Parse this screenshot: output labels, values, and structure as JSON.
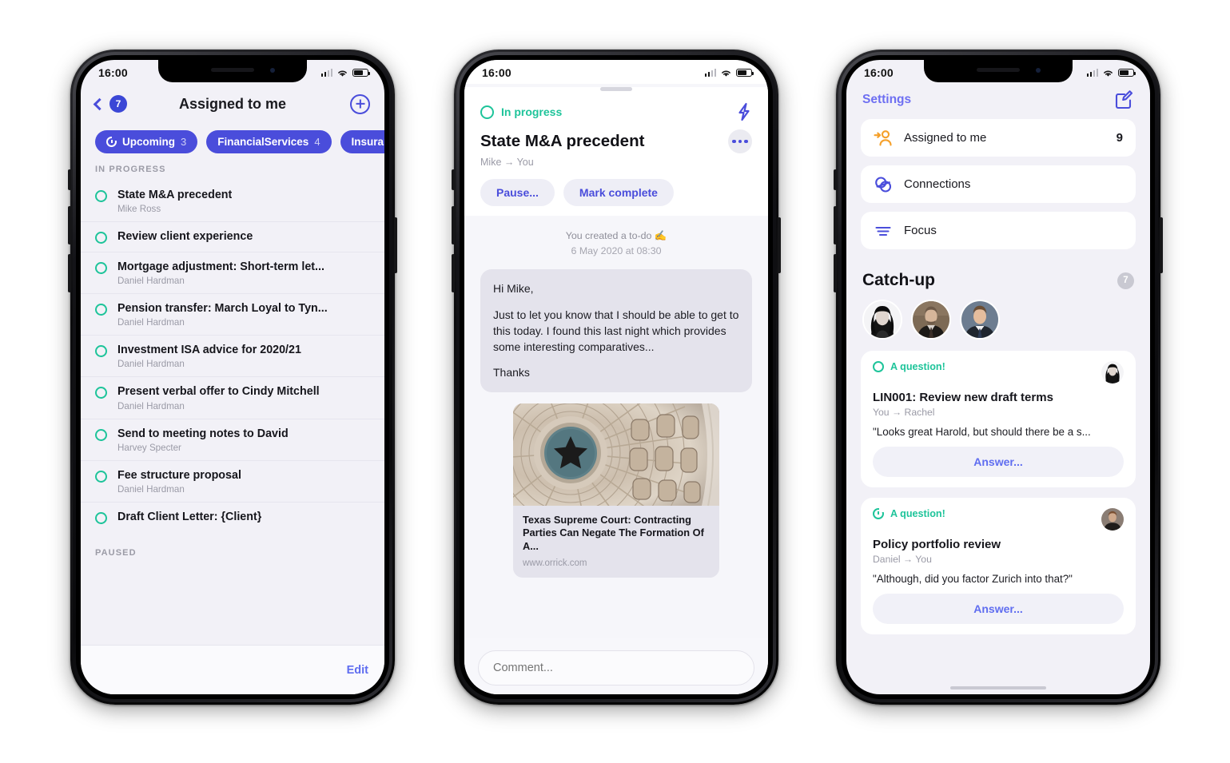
{
  "status_bar": {
    "time": "16:00"
  },
  "phone1": {
    "nav": {
      "back_badge": "7",
      "title": "Assigned to me",
      "add_label": "add-todo"
    },
    "filters": [
      {
        "label": "Upcoming",
        "count": "3",
        "icon": "clock-icon"
      },
      {
        "label": "FinancialServices",
        "count": "4",
        "icon": ""
      },
      {
        "label": "Insurance",
        "count": "",
        "icon": ""
      }
    ],
    "section_in_progress": "IN PROGRESS",
    "section_paused": "PAUSED",
    "tasks": [
      {
        "title": "State M&A precedent",
        "assignee": "Mike Ross"
      },
      {
        "title": "Review client experience",
        "assignee": ""
      },
      {
        "title": "Mortgage adjustment: Short-term let...",
        "assignee": "Daniel Hardman"
      },
      {
        "title": "Pension transfer: March Loyal to Tyn...",
        "assignee": "Daniel Hardman"
      },
      {
        "title": "Investment ISA advice for 2020/21",
        "assignee": "Daniel Hardman"
      },
      {
        "title": "Present verbal offer to Cindy Mitchell",
        "assignee": "Daniel Hardman"
      },
      {
        "title": "Send to meeting notes  to David",
        "assignee": "Harvey Specter"
      },
      {
        "title": "Fee structure proposal",
        "assignee": "Daniel Hardman"
      },
      {
        "title": "Draft Client Letter: {Client}",
        "assignee": ""
      }
    ],
    "footer": {
      "edit_label": "Edit"
    }
  },
  "phone2": {
    "status": {
      "label": "In progress"
    },
    "title": "State M&A precedent",
    "participants": "Mike → You",
    "actions": {
      "pause": "Pause...",
      "complete": "Mark complete"
    },
    "event": {
      "text": "You created a to-do ✍️",
      "date": "6 May 2020 at 08:30"
    },
    "message": {
      "greeting": "Hi Mike,",
      "body": "Just to let you know that I should be able to get to this today. I found this last night which provides some interesting comparatives...",
      "signoff": "Thanks"
    },
    "link_card": {
      "title": "Texas Supreme Court: Contracting Parties Can Negate The Formation Of A...",
      "url": "www.orrick.com",
      "image_alt": "texas-capitol-rotunda-photo"
    },
    "comment_placeholder": "Comment..."
  },
  "phone3": {
    "nav": {
      "settings": "Settings",
      "compose": "compose-icon"
    },
    "settings_items": [
      {
        "label": "Assigned to me",
        "count": "9",
        "icon": "assigned-person-icon"
      },
      {
        "label": "Connections",
        "count": "",
        "icon": "connections-icon"
      },
      {
        "label": "Focus",
        "count": "",
        "icon": "focus-icon"
      }
    ],
    "catchup": {
      "title": "Catch-up",
      "badge": "7",
      "avatars": [
        "avatar-rachel",
        "avatar-daniel",
        "avatar-mike"
      ],
      "cards": [
        {
          "status_icon": "circle-icon",
          "status_label": "A question!",
          "title": "LIN001: Review new draft terms",
          "participants": "You → Rachel",
          "quote": "\"Looks great Harold, but should there be a s...",
          "action": "Answer..."
        },
        {
          "status_icon": "clock-icon",
          "status_label": "A question!",
          "title": "Policy portfolio review",
          "participants": "Daniel → You",
          "quote": "\"Although, did you factor Zurich into that?\"",
          "action": "Answer..."
        }
      ]
    }
  },
  "colors": {
    "accent_indigo": "#4a4ddb",
    "accent_link": "#5f6df0",
    "teal": "#1ec49a",
    "orange": "#f5a02a",
    "screen_bg": "#f2f1f7"
  }
}
